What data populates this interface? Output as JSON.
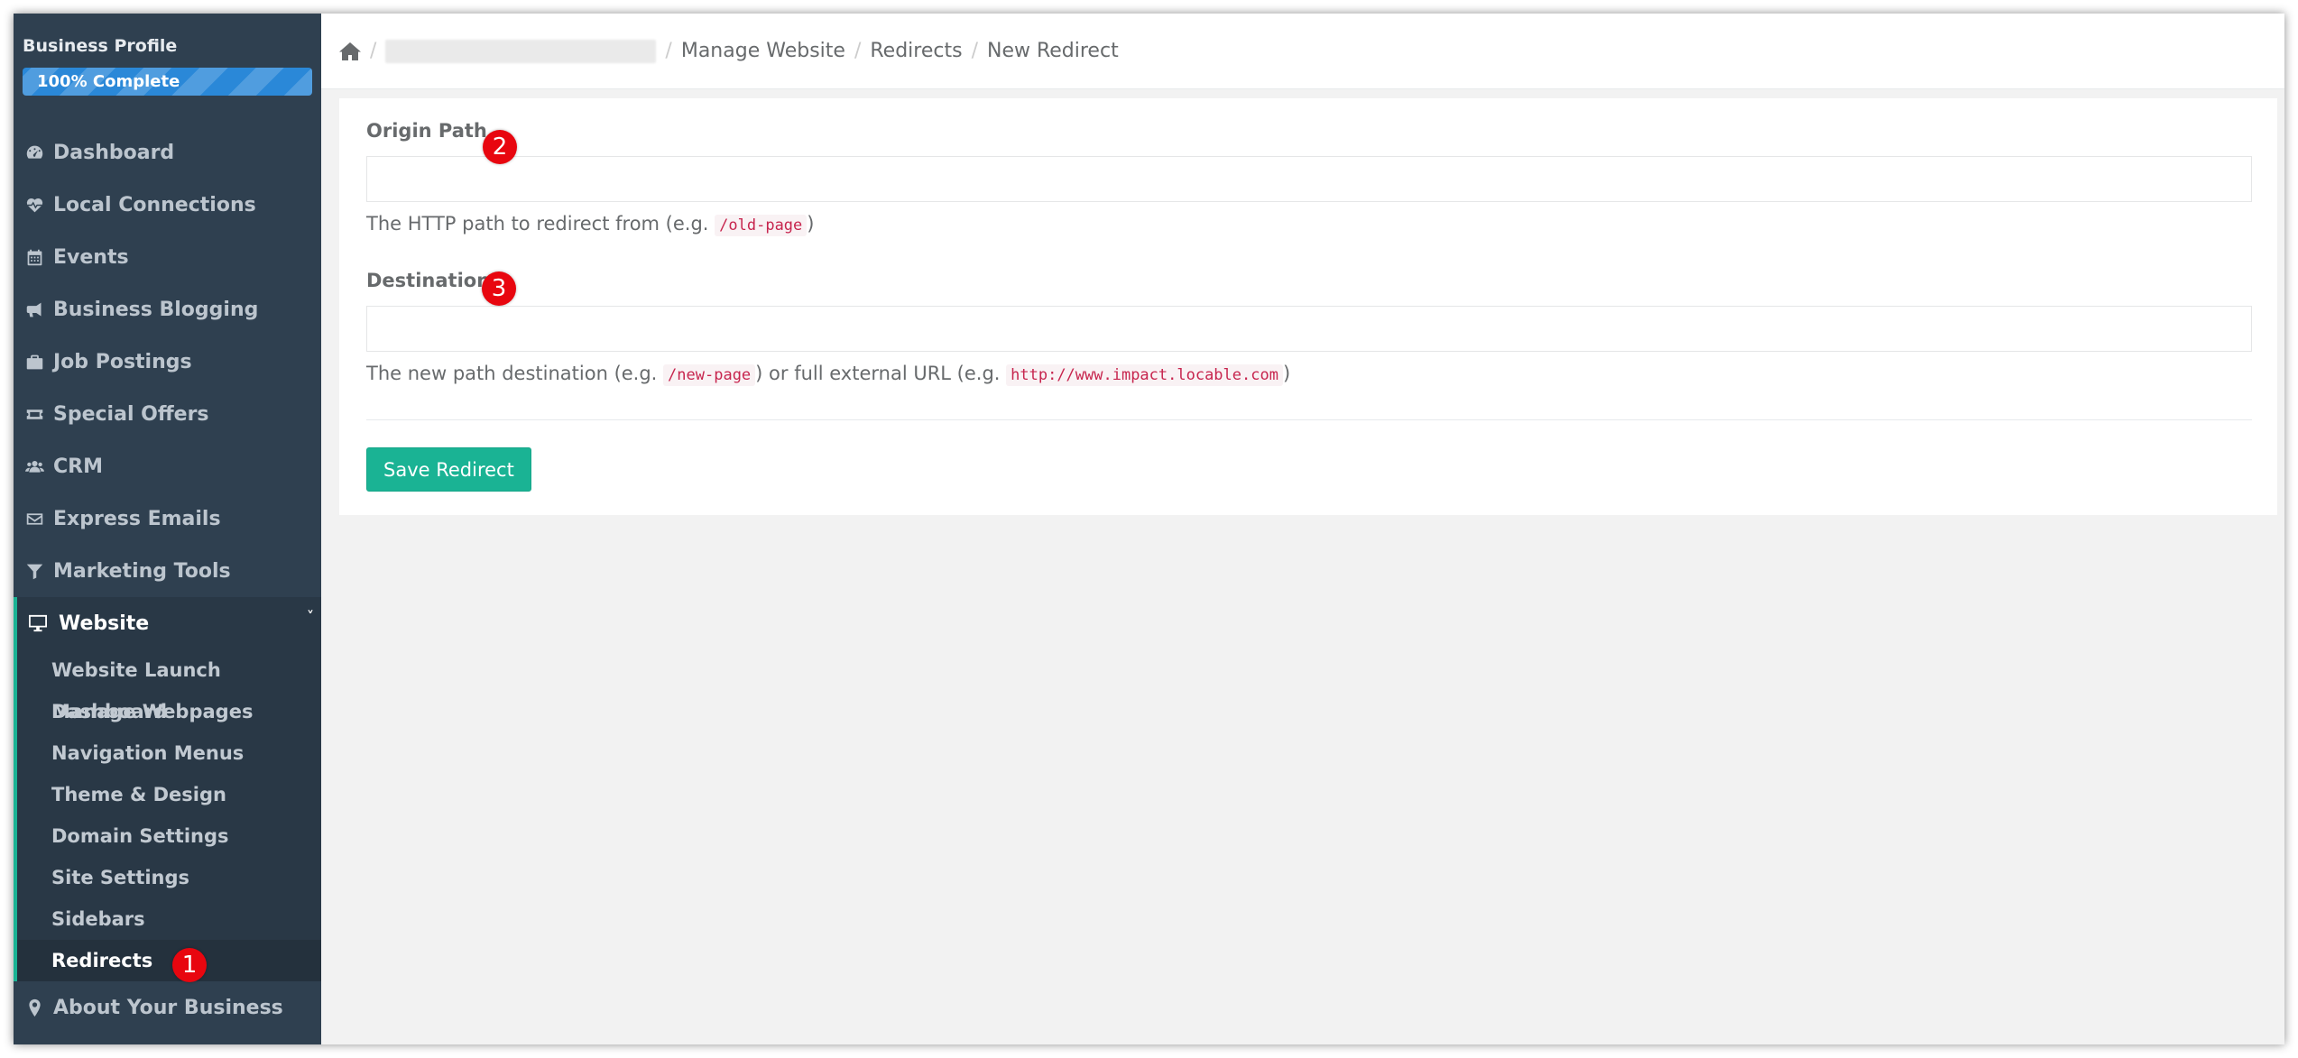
{
  "sidebar": {
    "profile_title": "Business Profile",
    "progress_label": "100% Complete",
    "progress_value": 100,
    "items": [
      {
        "label": "Dashboard",
        "icon": "tachometer-icon"
      },
      {
        "label": "Local Connections",
        "icon": "heartbeat-icon"
      },
      {
        "label": "Events",
        "icon": "calendar-icon"
      },
      {
        "label": "Business Blogging",
        "icon": "bullhorn-icon"
      },
      {
        "label": "Job Postings",
        "icon": "briefcase-icon"
      },
      {
        "label": "Special Offers",
        "icon": "ticket-icon"
      },
      {
        "label": "CRM",
        "icon": "users-icon"
      },
      {
        "label": "Express Emails",
        "icon": "envelope-icon"
      },
      {
        "label": "Marketing Tools",
        "icon": "filter-icon"
      }
    ],
    "website": {
      "label": "Website",
      "icon": "desktop-icon",
      "chevron": "˅",
      "sub_items": [
        "Website Launch Dashboard",
        "Manage Webpages",
        "Navigation Menus",
        "Theme & Design",
        "Domain Settings",
        "Site Settings",
        "Sidebars",
        "Redirects"
      ],
      "active_sub_item": "Redirects"
    },
    "about": {
      "label": "About Your Business",
      "icon": "map-marker-icon"
    }
  },
  "breadcrumb": {
    "separator": "/",
    "items": [
      "Manage Website",
      "Redirects",
      "New Redirect"
    ]
  },
  "form": {
    "origin": {
      "label": "Origin Path",
      "value": "",
      "help_prefix": "The HTTP path to redirect from (e.g. ",
      "help_code": "/old-page",
      "help_suffix": ")"
    },
    "destination": {
      "label": "Destination",
      "value": "",
      "help_prefix": "The new path destination (e.g. ",
      "help_code1": "/new-page",
      "help_middle": ") or full external URL (e.g. ",
      "help_code2": "http://www.impact.locable.com",
      "help_suffix": ")"
    },
    "save_label": "Save Redirect"
  },
  "badges": [
    "1",
    "2",
    "3"
  ],
  "colors": {
    "sidebar_bg": "#2f4050",
    "accent": "#1ab394",
    "progress": "#2a88d8",
    "badge": "#e8060f"
  }
}
